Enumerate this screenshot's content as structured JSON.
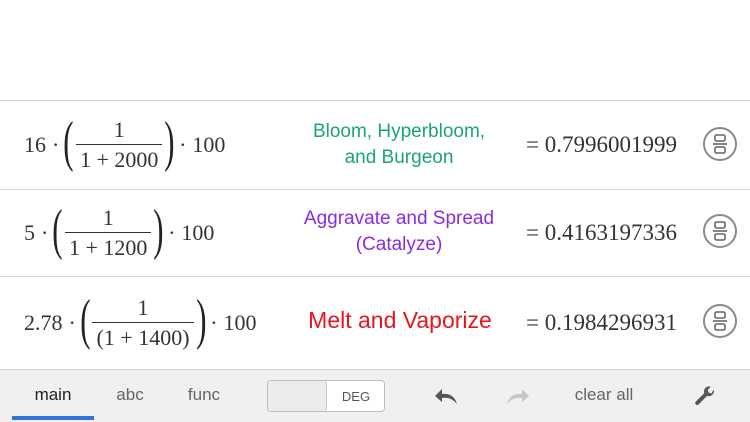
{
  "rows": [
    {
      "coefficient": "16",
      "numerator": "1",
      "denominator": "1 + 2000",
      "multiplier": "100",
      "label_line1": "Bloom, Hyperbloom,",
      "label_line2": "and Burgeon",
      "label_color": "#1aa37a",
      "result": "= 0.7996001999"
    },
    {
      "coefficient": "5",
      "numerator": "1",
      "denominator": "1 + 1200",
      "multiplier": "100",
      "label_line1": "Aggravate and Spread",
      "label_line2": "(Catalyze)",
      "label_color": "#8a2be2",
      "result": "= 0.4163197336"
    },
    {
      "coefficient": "2.78",
      "numerator": "1",
      "denominator": "(1 + 1400)",
      "multiplier": "100",
      "label_line1": "Melt and Vaporize",
      "label_color": "#e8141e",
      "result": "= 0.1984296931"
    }
  ],
  "keypad": {
    "tabs": [
      "main",
      "abc",
      "func"
    ],
    "active_tab": "main",
    "angle_mode": "DEG",
    "clear_label": "clear all",
    "icons": {
      "undo": "undo-arrow-icon",
      "redo": "redo-arrow-icon",
      "settings": "wrench-icon",
      "format": "fraction-toggle-icon"
    },
    "accent_color": "#2f72dc"
  }
}
